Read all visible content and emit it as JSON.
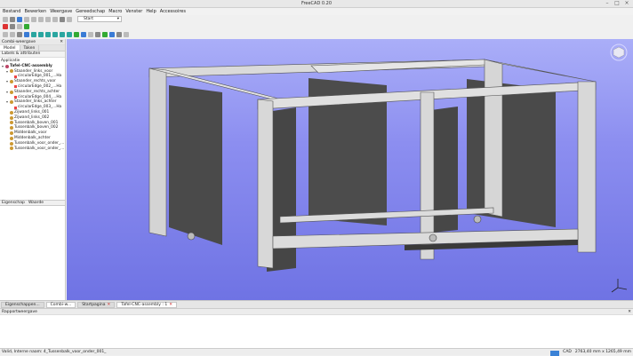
{
  "window": {
    "title": "FreeCAD 0.20"
  },
  "menu": [
    "Bestand",
    "Bewerken",
    "Weergave",
    "Gereedschap",
    "Macro",
    "Venster",
    "Help",
    "Accessoires"
  ],
  "toolbar": {
    "workbench": "Start"
  },
  "combo": {
    "title": "Combi-weergave",
    "tabs": [
      "Model",
      "Taken"
    ],
    "section": "Labels & attributen",
    "group": "Applicatie"
  },
  "tree": [
    {
      "label": "Tafel-CNC-assembly",
      "level": 0,
      "icon": "assembly-icon"
    },
    {
      "label": "Staander_links_voor",
      "level": 1,
      "icon": "part-icon"
    },
    {
      "label": "circularEdge_001_...Ha",
      "level": 2,
      "icon": "sketch-icon"
    },
    {
      "label": "Staander_rechts_voor",
      "level": 1,
      "icon": "part-icon"
    },
    {
      "label": "circularEdge_002_...Ha",
      "level": 2,
      "icon": "sketch-icon"
    },
    {
      "label": "Staander_rechts_achter",
      "level": 1,
      "icon": "part-icon"
    },
    {
      "label": "circularEdge_004_...Ha",
      "level": 2,
      "icon": "sketch-icon"
    },
    {
      "label": "Staander_links_achter",
      "level": 1,
      "icon": "part-icon"
    },
    {
      "label": "circularEdge_003_...Ha",
      "level": 2,
      "icon": "sketch-icon"
    },
    {
      "label": "Zijwand_links_001",
      "level": 1,
      "icon": "part-icon"
    },
    {
      "label": "Zijwand_links_002",
      "level": 1,
      "icon": "part-icon"
    },
    {
      "label": "Tussenbalk_boven_001",
      "level": 1,
      "icon": "part-icon"
    },
    {
      "label": "Tussenbalk_boven_002",
      "level": 1,
      "icon": "part-icon"
    },
    {
      "label": "Middenbalk_voor",
      "level": 1,
      "icon": "part-icon"
    },
    {
      "label": "Middenbalk_achter",
      "level": 1,
      "icon": "part-icon"
    },
    {
      "label": "Tussenbalk_voor_onder_...",
      "level": 1,
      "icon": "part-icon"
    },
    {
      "label": "Tussenbalk_voor_onder_...",
      "level": 1,
      "icon": "part-icon"
    }
  ],
  "properties": {
    "col_property": "Eigenschap",
    "col_value": "Waarde"
  },
  "panel_tabs": [
    "Aanzicht",
    "Gegevens"
  ],
  "doc_tabs": [
    {
      "label": "Eigenschappen...",
      "active": false,
      "closable": false
    },
    {
      "label": "Combi-w...",
      "active": true,
      "closable": false
    },
    {
      "label": "Startpagina",
      "active": false,
      "closable": true
    },
    {
      "label": "Tafel-CNC-assembly : 1",
      "active": false,
      "closable": true
    }
  ],
  "report": {
    "title": "Rapportweergave"
  },
  "status": {
    "message": "Valid, Interne naam: 4_Tussenbalk_voor_onder_001_",
    "nav_style": "CAD",
    "dimensions": "2763,40 mm x 1265,49 mm"
  },
  "colors": {
    "viewport_top": "#aaaef8",
    "viewport_bottom": "#6f73e4",
    "frame": "#d9d9d9",
    "panel": "#4a4a4a"
  }
}
